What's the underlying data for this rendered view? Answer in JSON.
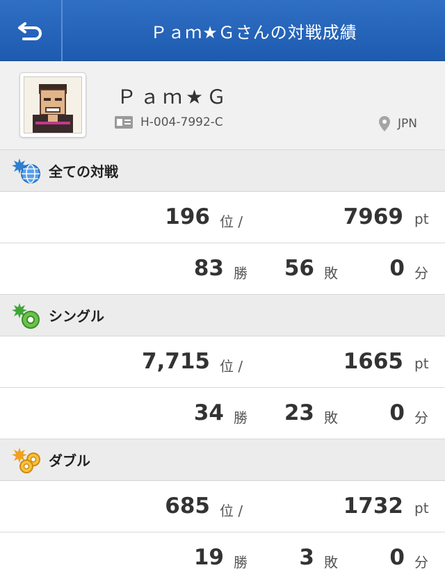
{
  "header": {
    "title": "Ｐａｍ★Ｇさんの対戦成績"
  },
  "profile": {
    "name": "Ｐａｍ★Ｇ",
    "id": "H-004-7992-C",
    "region": "JPN"
  },
  "sections": [
    {
      "title": "全ての対戦",
      "rank": "196",
      "rank_unit": "位 /",
      "points": "7969",
      "points_unit": "pt",
      "wins": "83",
      "wins_unit": "勝",
      "losses": "56",
      "losses_unit": "敗",
      "draws": "0",
      "draws_unit": "分"
    },
    {
      "title": "シングル",
      "rank": "7,715",
      "rank_unit": "位 /",
      "points": "1665",
      "points_unit": "pt",
      "wins": "34",
      "wins_unit": "勝",
      "losses": "23",
      "losses_unit": "敗",
      "draws": "0",
      "draws_unit": "分"
    },
    {
      "title": "ダブル",
      "rank": "685",
      "rank_unit": "位 /",
      "points": "1732",
      "points_unit": "pt",
      "wins": "19",
      "wins_unit": "勝",
      "losses": "3",
      "losses_unit": "敗",
      "draws": "0",
      "draws_unit": "分"
    }
  ],
  "colors": {
    "header": "#2466bb",
    "accent_green": "#3fa535",
    "accent_blue": "#2f7fd0",
    "accent_orange": "#f0a020"
  }
}
